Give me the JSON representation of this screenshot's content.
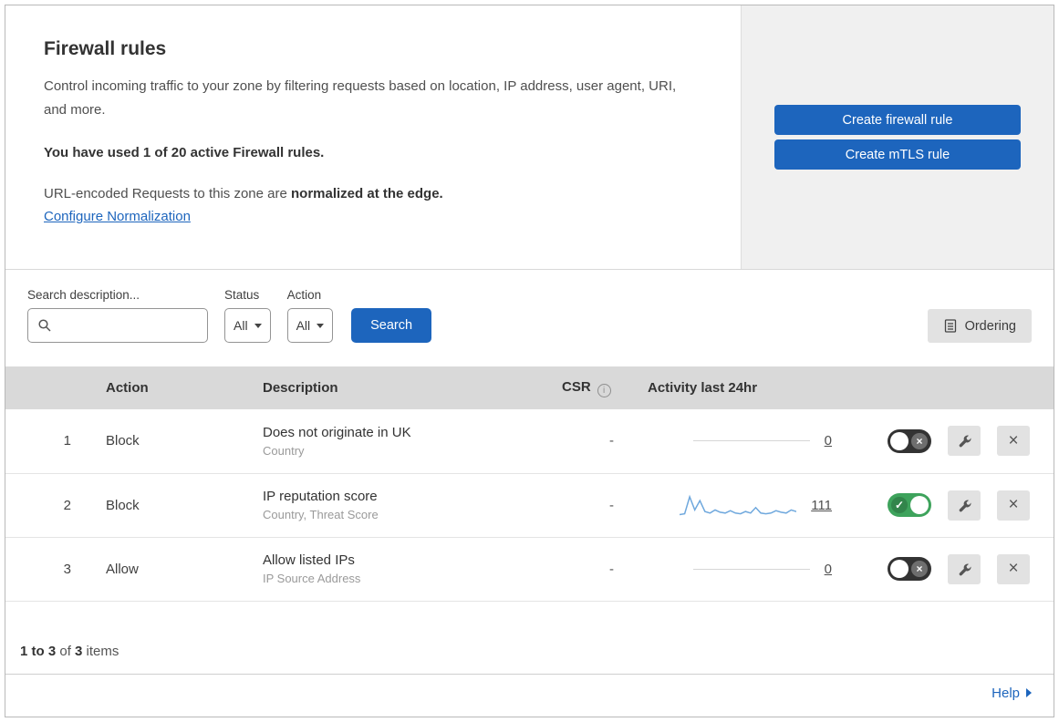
{
  "colors": {
    "primary": "#1d65bd",
    "toggle-on": "#3ea35c",
    "toggle-off": "#333333",
    "sparkline": "#6fa8dd",
    "panel-bg": "#f0f0f0",
    "table-header-bg": "#d9d9d9",
    "icon-btn-bg": "#e2e2e2",
    "text": "#3c3c3c",
    "subtext": "#9a9a9a",
    "border": "#b9b9b9",
    "row-border": "#e4e4e4"
  },
  "header": {
    "title": "Firewall rules",
    "description": "Control incoming traffic to your zone by filtering requests based on location, IP address, user agent, URI, and more.",
    "usage": "You have used 1 of 20 active Firewall rules.",
    "normalization_text": "URL-encoded Requests to this zone are",
    "normalization_bold": "normalized at the edge.",
    "normalization_link": "Configure Normalization",
    "buttons": {
      "create_firewall": "Create firewall rule",
      "create_mtls": "Create mTLS rule"
    }
  },
  "filters": {
    "search_label": "Search description...",
    "status_label": "Status",
    "status_value": "All",
    "action_label": "Action",
    "action_value": "All",
    "search_button": "Search",
    "ordering_button": "Ordering"
  },
  "table": {
    "columns": {
      "action": "Action",
      "description": "Description",
      "csr": "CSR",
      "activity": "Activity last 24hr"
    },
    "rows": [
      {
        "index": "1",
        "action": "Block",
        "description": "Does not originate in UK",
        "fields": "Country",
        "csr": "-",
        "activity": "0",
        "enabled": false
      },
      {
        "index": "2",
        "action": "Block",
        "description": "IP reputation score",
        "fields": "Country, Threat Score",
        "csr": "-",
        "activity": "111",
        "enabled": true,
        "sparkline": [
          3,
          4,
          26,
          9,
          21,
          7,
          5,
          9,
          6,
          5,
          8,
          5,
          4,
          7,
          5,
          12,
          5,
          4,
          5,
          8,
          6,
          5,
          9,
          7
        ]
      },
      {
        "index": "3",
        "action": "Allow",
        "description": "Allow listed IPs",
        "fields": "IP Source Address",
        "csr": "-",
        "activity": "0",
        "enabled": false
      }
    ]
  },
  "footer": {
    "range": "1 to 3",
    "of": " of ",
    "total": "3",
    "items": " items",
    "help": "Help"
  }
}
